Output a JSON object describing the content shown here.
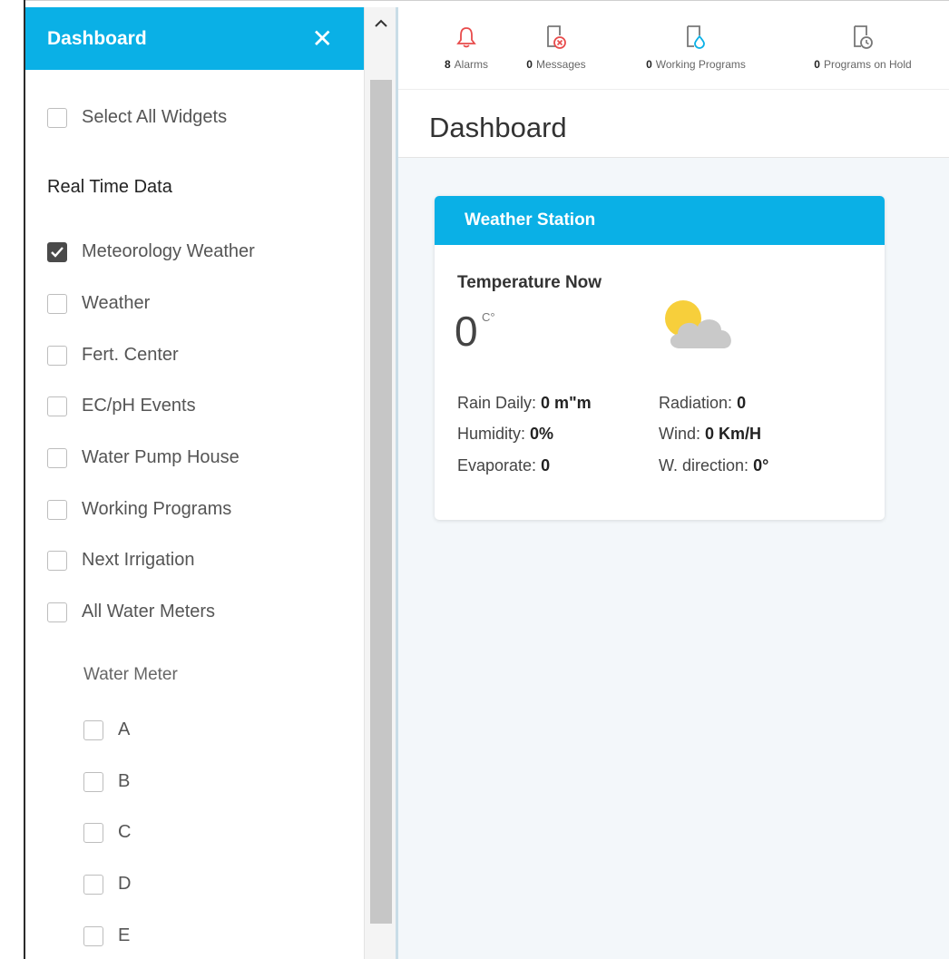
{
  "sidebar": {
    "title": "Dashboard",
    "close_glyph": "✕",
    "select_all": "Select All Widgets",
    "section": "Real Time Data",
    "widgets": [
      {
        "label": "Meteorology Weather",
        "checked": true
      },
      {
        "label": "Weather",
        "checked": false
      },
      {
        "label": "Fert. Center",
        "checked": false
      },
      {
        "label": "EC/pH Events",
        "checked": false
      },
      {
        "label": "Water Pump House",
        "checked": false
      },
      {
        "label": "Working Programs",
        "checked": false
      },
      {
        "label": "Next Irrigation",
        "checked": false
      },
      {
        "label": "All Water Meters",
        "checked": false
      }
    ],
    "water_meter_label": "Water Meter",
    "water_meters": [
      "A",
      "B",
      "C",
      "D",
      "E"
    ]
  },
  "scrollbar": {
    "up_glyph": "^"
  },
  "topbar": {
    "alarms": {
      "count": "8",
      "label": "Alarms",
      "icon": "bell-icon"
    },
    "messages": {
      "count": "0",
      "label": "Messages",
      "icon": "message-error-icon"
    },
    "working": {
      "count": "0",
      "label": "Working Programs",
      "icon": "water-drop-icon"
    },
    "hold": {
      "count": "0",
      "label": "Programs on Hold",
      "icon": "clock-icon"
    }
  },
  "page": {
    "title": "Dashboard"
  },
  "weather_card": {
    "title": "Weather Station",
    "temp_label": "Temperature Now",
    "temp_value": "0",
    "temp_unit": "C°",
    "icon": "partly-cloudy-icon",
    "rain_label": "Rain Daily:",
    "rain_value": "0 m\"m",
    "radiation_label": "Radiation:",
    "radiation_value": "0",
    "humidity_label": "Humidity:",
    "humidity_value": "0%",
    "wind_label": "Wind:",
    "wind_value": "0 Km/H",
    "evaporate_label": "Evaporate:",
    "evaporate_value": "0",
    "direction_label": "W. direction:",
    "direction_value": "0°"
  },
  "colors": {
    "accent": "#0ab0e6",
    "alarm": "#e84b4b",
    "background": "#f3f7fa"
  }
}
